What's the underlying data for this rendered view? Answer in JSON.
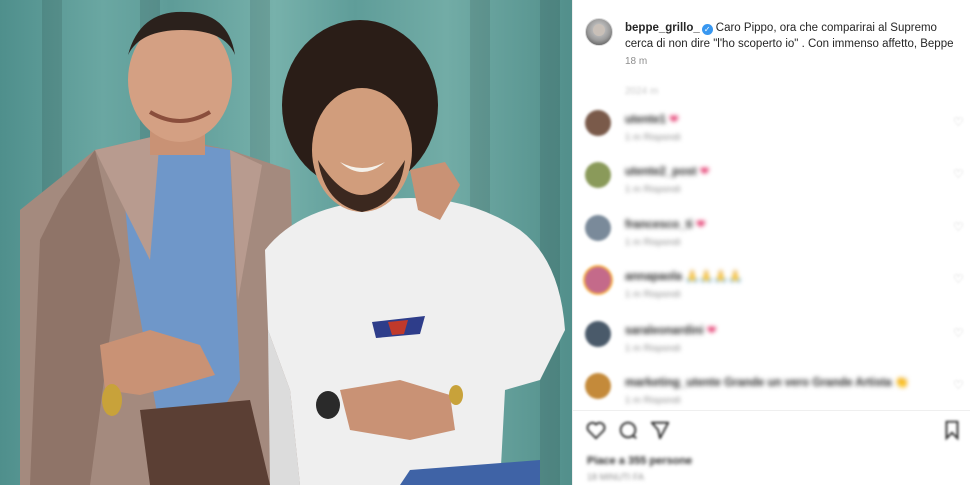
{
  "post": {
    "username": "beppe_grillo_",
    "caption": "Caro Pippo, ora che comparirai al Supremo cerca di non dire \"l'ho scoperto io\" . Con immenso affetto, Beppe",
    "time": "18 m"
  },
  "comments_header": "2024 m",
  "comments": [
    {
      "user": "utente1",
      "text": "❤",
      "meta": "1 m   Rispondi",
      "avatar_color": "#7a5a4a"
    },
    {
      "user": "utente2_post",
      "text": "❤",
      "meta": "1 m   Rispondi",
      "avatar_color": "#8a9a5a"
    },
    {
      "user": "francesco_ti",
      "text": "❤",
      "meta": "1 m   Rispondi",
      "avatar_color": "#7a8a9a"
    },
    {
      "user": "annapaola",
      "text": "🙏🙏🙏🙏",
      "meta": "1 m   Rispondi",
      "avatar_color": "#c46a8a"
    },
    {
      "user": "saraleonardini",
      "text": "❤",
      "meta": "1 m   Rispondi",
      "avatar_color": "#4a5a6a"
    },
    {
      "user": "marketing_utente",
      "text": "Grande un vero Grande Artista 👏",
      "meta": "1 m   Rispondi",
      "avatar_color": "#c48a3a"
    }
  ],
  "likes": "Piace a 355 persone",
  "date": "18 MINUTI FA",
  "icons": [
    "heart-icon",
    "comment-icon",
    "share-icon",
    "bookmark-icon",
    "verified-icon"
  ],
  "colors": {
    "verified": "#3897f0",
    "curtain": "#6aa7a2",
    "secondary_text": "#8e8e8e"
  }
}
